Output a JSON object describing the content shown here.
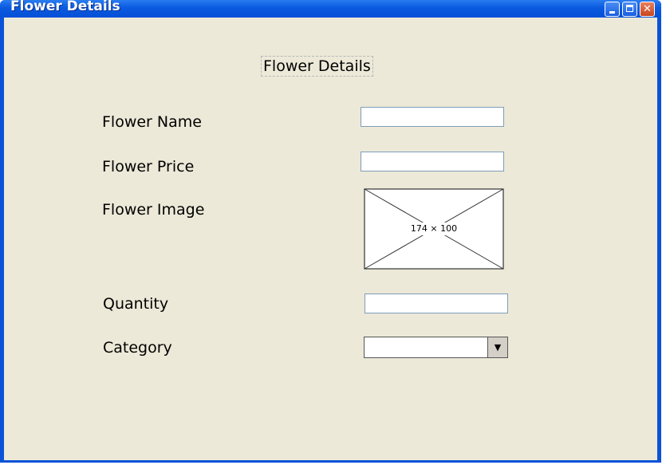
{
  "window": {
    "title": "Flower Details"
  },
  "form": {
    "heading": "Flower Details",
    "flower_name": {
      "label": "Flower Name",
      "value": ""
    },
    "flower_price": {
      "label": "Flower Price",
      "value": ""
    },
    "flower_image": {
      "label": "Flower Image",
      "placeholder_text": "174 × 100"
    },
    "quantity": {
      "label": "Quantity",
      "value": ""
    },
    "category": {
      "label": "Category",
      "selected": ""
    }
  },
  "icons": {
    "minimize": "minimize-icon",
    "maximize": "maximize-icon",
    "close": "close-icon",
    "dropdown": "chevron-down-icon"
  },
  "colors": {
    "titlebar": "#0a5ae0",
    "client_bg": "#ece9d8",
    "close_button": "#c6451f",
    "input_border": "#7f9db9"
  }
}
